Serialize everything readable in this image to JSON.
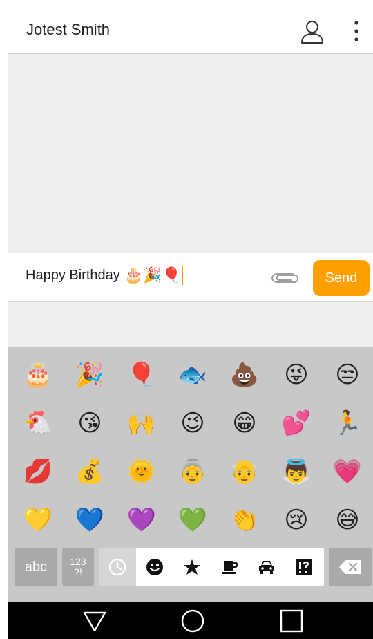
{
  "header": {
    "title": "Jotest Smith",
    "contact_icon": "person-icon",
    "menu_icon": "more-vert-icon"
  },
  "composer": {
    "text": "Happy Birthday",
    "emojis": [
      "🎂",
      "🎉",
      "🎈"
    ],
    "attach_icon": "paperclip-icon",
    "send_label": "Send"
  },
  "keyboard": {
    "emoji_grid": [
      [
        "🎂",
        "🎉",
        "🎈",
        "🐟",
        "💩",
        "😜",
        "😒"
      ],
      [
        "🐔",
        "😘",
        "🙌",
        "😉",
        "😁",
        "💕",
        "🏃"
      ],
      [
        "💋",
        "💰",
        "🌞",
        "👵",
        "👴",
        "👼",
        "💗"
      ],
      [
        "💛",
        "💙",
        "💜",
        "💚",
        "👏",
        "😢",
        "😅"
      ]
    ],
    "abc_label": "abc",
    "sym_label_top": "123",
    "sym_label_bottom": "?!",
    "categories": [
      {
        "icon": "clock-icon",
        "active": true
      },
      {
        "icon": "smiley-icon",
        "active": false
      },
      {
        "icon": "star-icon",
        "active": false
      },
      {
        "icon": "coffee-icon",
        "active": false
      },
      {
        "icon": "car-icon",
        "active": false
      },
      {
        "icon": "symbols-icon",
        "active": false
      }
    ],
    "delete_icon": "backspace-icon"
  },
  "navbar": {
    "back_icon": "back-triangle-icon",
    "home_icon": "home-circle-icon",
    "recents_icon": "recents-square-icon"
  },
  "colors": {
    "accent": "#ffa000",
    "keyboard_bg": "#c8c8c8",
    "key_bg": "#a9a9a9",
    "message_bg": "#eeeeee"
  }
}
